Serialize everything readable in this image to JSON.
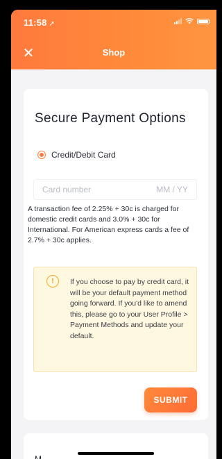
{
  "status_bar": {
    "time": "11:58",
    "location_icon": "location-arrow-icon",
    "signal_icon": "signal-icon",
    "wifi_icon": "wifi-icon",
    "battery_icon": "battery-icon"
  },
  "nav": {
    "close_icon": "close-icon",
    "close_glyph": "✕",
    "title": "Shop"
  },
  "payment": {
    "title": "Secure Payment Options",
    "option_label": "Credit/Debit Card",
    "card_placeholder": "Card number",
    "expiry_placeholder": "MM / YY",
    "fee_text": "A transaction fee of 2.25% + 30c is charged for domestic credit cards and 3.0% + 30c for International. For American express cards a fee of 2.7% + 30c applies.",
    "notice_icon": "info-icon",
    "notice_glyph": "!",
    "notice_text": "If you choose to pay by credit card, it will be your default payment method going forward. If you'd like to amend this, please go to your User Profile > Payment Methods and update your default.",
    "submit_label": "SUBMIT"
  },
  "next_section": {
    "peek_text": "M"
  },
  "colors": {
    "accent": "#ff7a3d",
    "notice_bg": "#fff8e1",
    "notice_icon": "#f5a623"
  }
}
